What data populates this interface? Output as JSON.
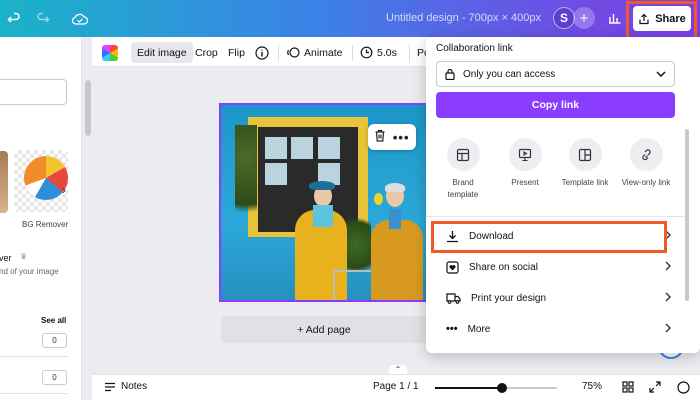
{
  "topbar": {
    "design_title": "Untitled design - 700px × 400px",
    "avatar_initial": "S",
    "share_label": "Share"
  },
  "context_toolbar": {
    "edit_image": "Edit image",
    "crop": "Crop",
    "flip": "Flip",
    "animate": "Animate",
    "duration": "5.0s",
    "position_partial": "Po"
  },
  "left_panel": {
    "bg_remover": "BG Remover",
    "remover_title_partial": "ver",
    "remover_desc_partial": "nd of your image",
    "see_all": "See all",
    "field1_value": "0",
    "field2_value": "0"
  },
  "canvas": {
    "add_page": "+ Add page"
  },
  "bottombar": {
    "notes": "Notes",
    "page_indicator": "Page 1 / 1",
    "zoom": "75%",
    "zoom_fraction": 0.55
  },
  "share_menu": {
    "heading": "Collaboration link",
    "access_value": "Only you can access",
    "copy_link": "Copy link",
    "options": [
      {
        "label1": "Brand",
        "label2": "template"
      },
      {
        "label1": "Present",
        "label2": ""
      },
      {
        "label1": "Template link",
        "label2": ""
      },
      {
        "label1": "View-only link",
        "label2": ""
      }
    ],
    "rows": {
      "download": "Download",
      "share_social": "Share on social",
      "print": "Print your design",
      "more": "More"
    }
  },
  "colors": {
    "accent": "#8b3dff",
    "highlight": "#f05a28"
  }
}
